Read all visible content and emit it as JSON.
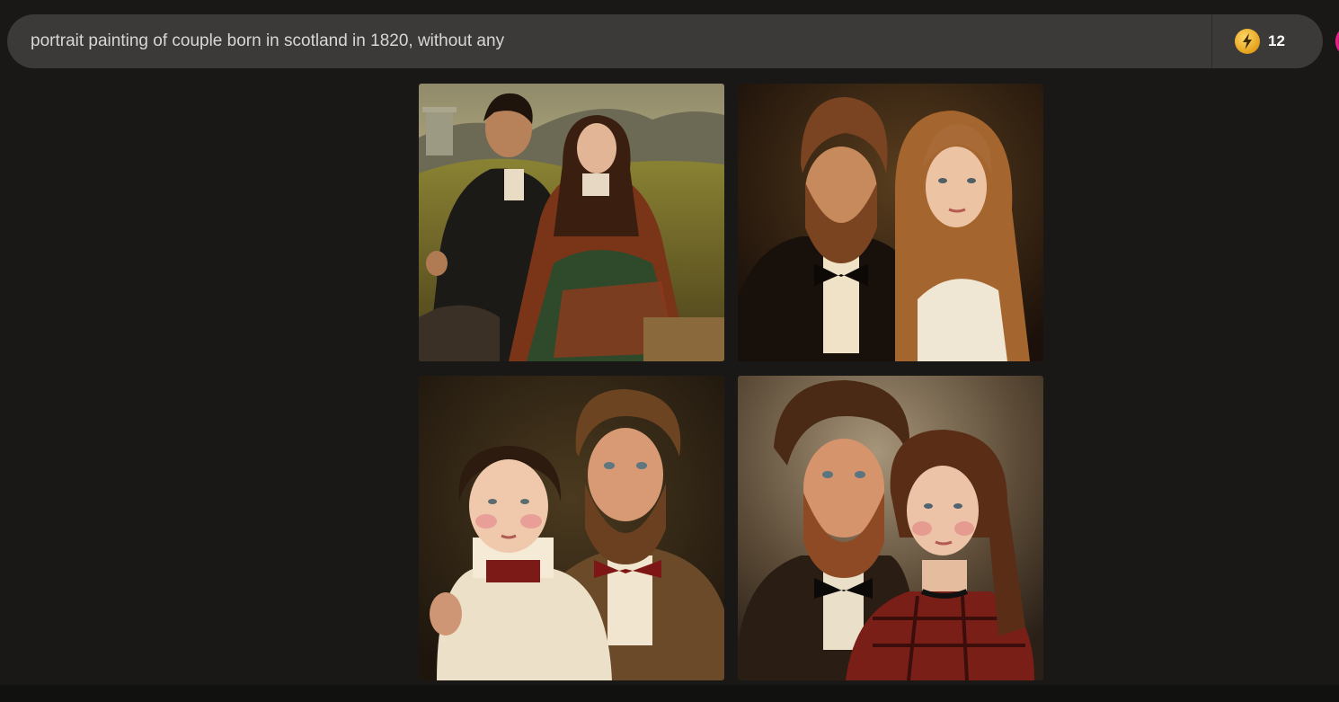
{
  "search": {
    "query": "portrait painting of couple born in scotland in 1820, without any"
  },
  "boosts": {
    "icon": "lightning-bolt-icon",
    "count": "12",
    "icon_color": "#f5b731"
  },
  "colors": {
    "page_background": "#191817",
    "search_bar_background": "#3b3a39",
    "avatar_accent": "#e91e8c"
  },
  "images": [
    {
      "subject": "couple seated outdoors in highland landscape, woman in tartan shawl"
    },
    {
      "subject": "bearded man in black coat and bow tie beside woman with long auburn hair"
    },
    {
      "subject": "woman in white ruffled blouse with bearded man in brown jacket"
    },
    {
      "subject": "bearded man with curly hair beside woman with braid in red tartan"
    }
  ]
}
